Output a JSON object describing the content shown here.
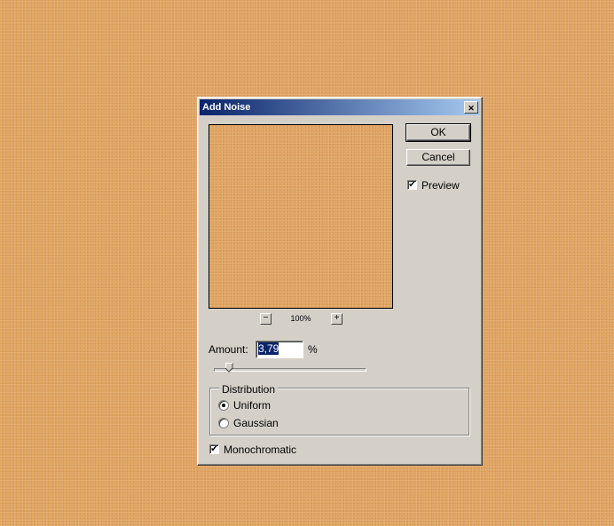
{
  "dialog": {
    "title": "Add Noise",
    "close_glyph": "✕",
    "ok_label": "OK",
    "cancel_label": "Cancel",
    "preview_label": "Preview",
    "preview_checked": true,
    "zoom_out": "−",
    "zoom_in": "+",
    "zoom_level": "100%",
    "amount_label": "Amount:",
    "amount_value": "3,79",
    "amount_unit": "%",
    "amount_slider_fraction": 0.1,
    "distribution": {
      "legend": "Distribution",
      "options": [
        "Uniform",
        "Gaussian"
      ],
      "selected": "Uniform"
    },
    "monochromatic_label": "Monochromatic",
    "monochromatic_checked": true,
    "check_glyph": "✔"
  },
  "colors": {
    "title_start": "#0a246a",
    "title_end": "#a6caf0",
    "face": "#d4d0c8",
    "canvas": "#e0a462"
  }
}
